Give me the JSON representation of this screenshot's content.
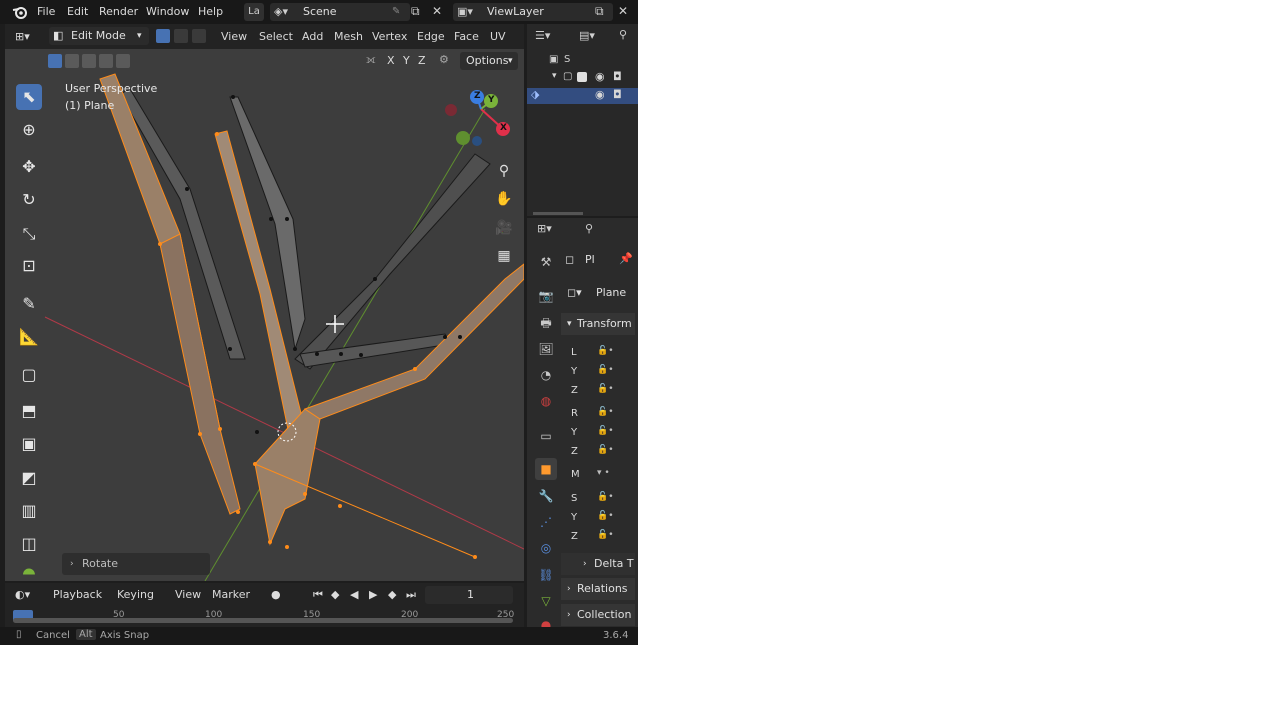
{
  "menu": {
    "file": "File",
    "edit": "Edit",
    "render": "Render",
    "window": "Window",
    "help": "Help"
  },
  "workspace_tab": "La",
  "scene": {
    "name": "Scene"
  },
  "view_layer": {
    "name": "ViewLayer"
  },
  "viewport_header": {
    "mode": "Edit Mode",
    "view": "View",
    "select": "Select",
    "add": "Add",
    "mesh": "Mesh",
    "vertex": "Vertex",
    "edge": "Edge",
    "face": "Face",
    "uv": "UV",
    "axis_x": "X",
    "axis_y": "Y",
    "axis_z": "Z",
    "options": "Options"
  },
  "viewport": {
    "perspective": "User Perspective",
    "object": "(1) Plane",
    "operator_panel": "Rotate",
    "gizmo": {
      "x": "X",
      "y": "Y",
      "z": "Z"
    },
    "colors": {
      "x_axis": "#e0304a",
      "y_axis": "#7ab33a",
      "z_axis": "#3a7de0",
      "selection": "#ff8c1a",
      "background": "#3d3d3d"
    }
  },
  "timeline": {
    "playback": "Playback",
    "keying": "Keying",
    "view": "View",
    "marker": "Marker",
    "current_frame": "1",
    "ruler": [
      "50",
      "100",
      "150",
      "200",
      "250"
    ]
  },
  "statusbar": {
    "cancel": "Cancel",
    "alt_key": "Alt",
    "axis_snap": "Axis Snap",
    "version": "3.6.4"
  },
  "outliner": {
    "scene_label": "S"
  },
  "properties": {
    "object_short": "Pl",
    "object_name": "Plane",
    "transform_label": "Transform",
    "rows": [
      "L",
      "Y",
      "Z",
      "R",
      "Y",
      "Z",
      "M",
      "S",
      "Y",
      "Z"
    ],
    "delta_label": "Delta T",
    "relations_label": "Relations",
    "collections_label": "Collection"
  }
}
